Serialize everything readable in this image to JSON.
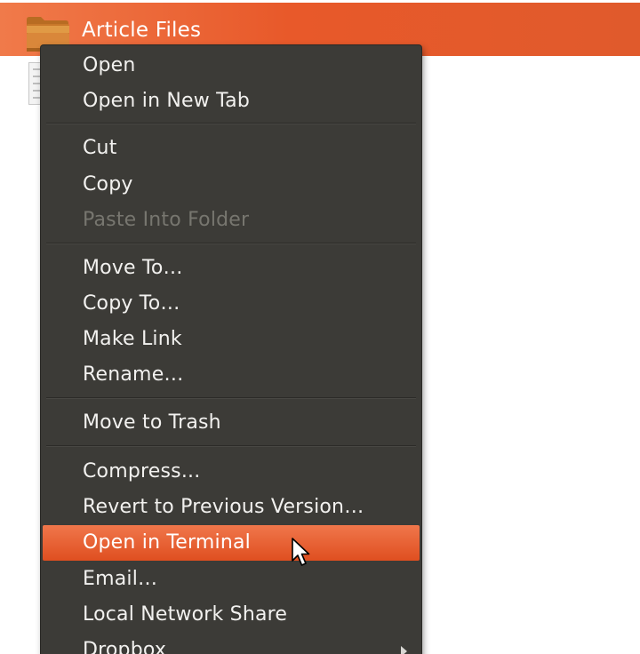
{
  "file": {
    "name": "Article Files",
    "icon": "folder-icon"
  },
  "menu": {
    "open": "Open",
    "open_new_tab": "Open in New Tab",
    "cut": "Cut",
    "copy": "Copy",
    "paste_into_folder": "Paste Into Folder",
    "move_to": "Move To…",
    "copy_to": "Copy To…",
    "make_link": "Make Link",
    "rename": "Rename…",
    "move_to_trash": "Move to Trash",
    "compress": "Compress...",
    "revert": "Revert to Previous Version…",
    "open_terminal": "Open in Terminal",
    "email": "Email…",
    "local_network_share": "Local Network Share",
    "dropbox": "Dropbox"
  },
  "colors": {
    "selection": "#e8592a",
    "menu_bg": "#3c3b37",
    "menu_text": "#f2f1ef",
    "disabled_text": "#77766f"
  },
  "icons": {
    "submenu": "chevron-right-icon",
    "pointer": "mouse-pointer-icon",
    "document": "document-icon"
  }
}
